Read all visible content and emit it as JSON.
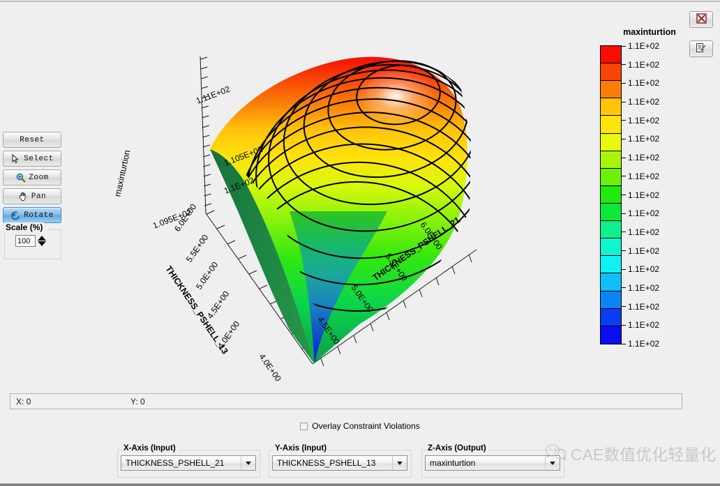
{
  "toolbar": {
    "buttons": [
      {
        "id": "reset",
        "label": "Reset",
        "icon": "none",
        "selected": false
      },
      {
        "id": "select",
        "label": "Select",
        "icon": "cursor-icon",
        "selected": false
      },
      {
        "id": "zoom",
        "label": "Zoom",
        "icon": "magnifier-icon",
        "selected": false
      },
      {
        "id": "pan",
        "label": "Pan",
        "icon": "hand-icon",
        "selected": false
      },
      {
        "id": "rotate",
        "label": "Rotate",
        "icon": "rotate-icon",
        "selected": true
      }
    ],
    "scale": {
      "legend": "Scale (%)",
      "value": "100"
    }
  },
  "window_buttons": {
    "close": {
      "icon": "red-x-icon",
      "tooltip": "Close"
    },
    "edit": {
      "icon": "edit-note-icon",
      "tooltip": "Edit"
    }
  },
  "legend": {
    "title": "maxinturtion",
    "labels": [
      "1.1E+02",
      "1.1E+02",
      "1.1E+02",
      "1.1E+02",
      "1.1E+02",
      "1.1E+02",
      "1.1E+02",
      "1.1E+02",
      "1.1E+02",
      "1.1E+02",
      "1.1E+02",
      "1.1E+02",
      "1.1E+02",
      "1.1E+02",
      "1.1E+02",
      "1.1E+02",
      "1.1E+02"
    ],
    "colors": [
      "#f90d05",
      "#f94405",
      "#fa7d08",
      "#ffc40b",
      "#ffe30c",
      "#e7f90c",
      "#a8f50c",
      "#6ef00c",
      "#22e90e",
      "#0ce93a",
      "#0cf08d",
      "#0ef5cf",
      "#0ef1f5",
      "#0ec0f7",
      "#0d84f4",
      "#0b3ef2",
      "#0a0df0"
    ]
  },
  "statusbar": {
    "x_label": "X: 0",
    "y_label": "Y: 0"
  },
  "overlay": {
    "label": "Overlay Constraint Violations",
    "checked": false
  },
  "axis_selectors": [
    {
      "id": "x-axis",
      "title": "X-Axis (Input)",
      "value": "THICKNESS_PSHELL_21"
    },
    {
      "id": "y-axis",
      "title": "Y-Axis (Input)",
      "value": "THICKNESS_PSHELL_13"
    },
    {
      "id": "z-axis",
      "title": "Z-Axis (Output)",
      "value": "maxinturtion"
    }
  ],
  "watermark": {
    "text": "CAE数值优化轻量化",
    "icon": "wechat-icon"
  },
  "chart_data": {
    "type": "surface",
    "title": "",
    "zlabel": "maxinturtion",
    "xlabel": "THICKNESS_PSHELL_21",
    "ylabel": "THICKNESS_PSHELL_13",
    "x_ticks": [
      "4.0E+00",
      "4.5E+00",
      "5.0E+00",
      "5.5E+00",
      "6.0E+00"
    ],
    "y_ticks": [
      "4.0E+00",
      "4.5E+00",
      "5.0E+00",
      "5.5E+00",
      "6.0E+00"
    ],
    "z_ticks": [
      "1.095E+02",
      "1.1E+02",
      "1.105E+02",
      "1.11E+02"
    ],
    "xlim": [
      4.0,
      6.0
    ],
    "ylim": [
      4.0,
      6.0
    ],
    "zlim": [
      109.5,
      111.0
    ],
    "grid": false,
    "legend_position": "right",
    "contour_lines": 13,
    "colormap": "jet-reversed",
    "description": "3D response-surface: dome peaking red at back-centre, falling to a deep blue valley at the front corner where both thicknesses are minimum."
  }
}
